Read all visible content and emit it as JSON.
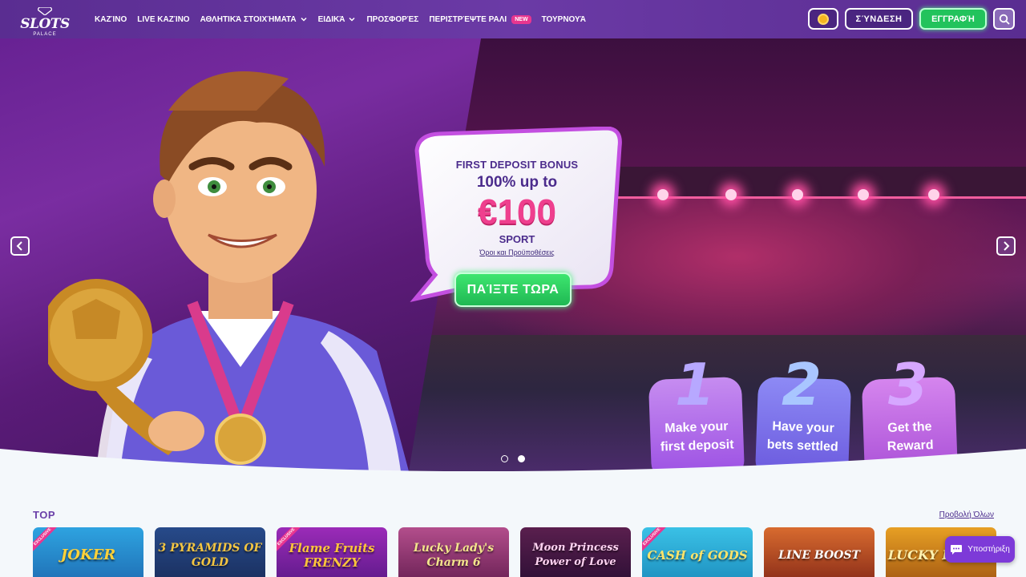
{
  "header": {
    "logo_name": "SLOTS",
    "logo_sub": "PALACE",
    "nav": [
      {
        "label": "ΚΑΖΊΝΟ",
        "has_dropdown": false
      },
      {
        "label": "LIVE ΚΑΖΊΝΟ",
        "has_dropdown": false
      },
      {
        "label": "ΑΘΛΗΤΙΚΆ ΣΤΟΙΧΉΜΑΤΑ",
        "has_dropdown": true
      },
      {
        "label": "ΕΙΔΙΚΆ",
        "has_dropdown": true
      },
      {
        "label": "ΠΡΟΣΦΟΡΈΣ",
        "has_dropdown": false
      },
      {
        "label": "ΠΕΡΙΣΤΡΈΨΤΕ ΡΑΛΙ",
        "has_dropdown": false,
        "badge": "NEW"
      },
      {
        "label": "ΤΟΥΡΝΟΥΆ",
        "has_dropdown": false
      }
    ],
    "login_label": "ΣΎΝΔΕΣΗ",
    "register_label": "ΕΓΓΡΑΦΉ"
  },
  "hero": {
    "bonus_title": "FIRST DEPOSIT BONUS",
    "bonus_sub": "100% up to",
    "bonus_amount": "€100",
    "bonus_type": "SPORT",
    "terms_link": "Όροι και Προϋποθέσεις",
    "cta_label": "ΠΑΊΞΤΕ ΤΩΡΑ",
    "steps": [
      {
        "num": "1",
        "text1": "Make your",
        "text2": "first deposit"
      },
      {
        "num": "2",
        "text1": "Have your",
        "text2": "bets settled"
      },
      {
        "num": "3",
        "text1": "Get the",
        "text2": "Reward"
      }
    ],
    "slide_count": 2,
    "active_slide": 2
  },
  "top_section": {
    "title": "TOP",
    "view_all": "Προβολή Όλων",
    "games": [
      {
        "title": "JOKER",
        "exclusive": true,
        "exclusive_label": "EXCLUSIVE"
      },
      {
        "title": "3 PYRAMIDS OF GOLD",
        "exclusive": false
      },
      {
        "title": "Flame Fruits FRENZY",
        "exclusive": true,
        "exclusive_label": "EXCLUSIVE"
      },
      {
        "title": "Lucky Lady's Charm 6",
        "exclusive": false
      },
      {
        "title": "Moon Princess Power of Love",
        "exclusive": false
      },
      {
        "title": "CASH of GODS",
        "exclusive": true,
        "exclusive_label": "EXCLUSIVE"
      },
      {
        "title": "LINE BOOST",
        "exclusive": false
      },
      {
        "title": "LUCKY PENNY",
        "exclusive": false
      }
    ]
  },
  "support_label": "Υποστήριξη",
  "colors": {
    "header_bg": "#5a2d91",
    "accent_pink": "#ef3f8e",
    "cta_green": "#22c35c",
    "text_purple": "#4b2b8c"
  }
}
